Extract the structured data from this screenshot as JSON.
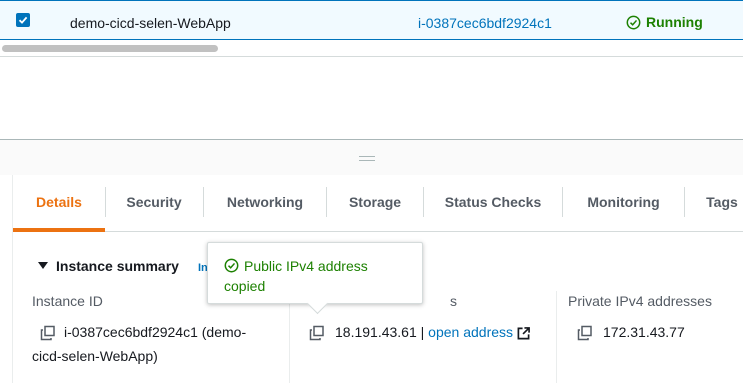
{
  "table_row": {
    "name": "demo-cicd-selen-WebApp",
    "instance_id": "i-0387cec6bdf2924c1",
    "status": "Running",
    "selected": true
  },
  "tabs": [
    {
      "label": "Details",
      "active": true
    },
    {
      "label": "Security"
    },
    {
      "label": "Networking"
    },
    {
      "label": "Storage"
    },
    {
      "label": "Status Checks"
    },
    {
      "label": "Monitoring"
    },
    {
      "label": "Tags"
    }
  ],
  "summary": {
    "title": "Instance summary",
    "info_link": "In"
  },
  "fields": {
    "instance_id_label": "Instance ID",
    "instance_id_value_line1": "i-0387cec6bdf2924c1 (demo-",
    "instance_id_value_line2": "cicd-selen-WebApp)",
    "public_ip_label_tail": "s",
    "public_ip_value": "18.191.43.61",
    "public_ip_separator": "|",
    "open_address_label": "open address",
    "private_ip_label": "Private IPv4 addresses",
    "private_ip_value": "172.31.43.77"
  },
  "tooltip": {
    "line1": "Public IPv4 address",
    "line2": "copied"
  },
  "colors": {
    "accent_orange": "#ec7211",
    "link_blue": "#0073bb",
    "success_green": "#1d8102"
  }
}
